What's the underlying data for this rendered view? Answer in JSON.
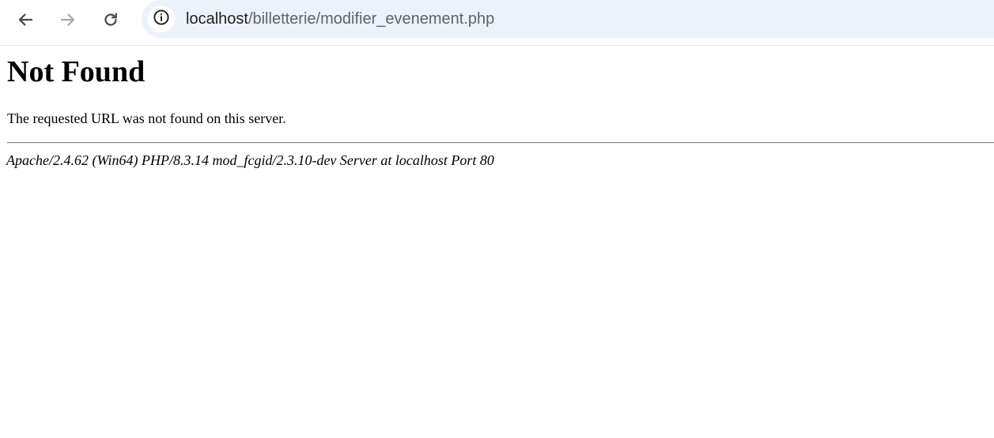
{
  "browser": {
    "address_bar": {
      "host": "localhost",
      "path": "/billetterie/modifier_evenement.php"
    },
    "icons": {
      "back": "arrow-left-icon",
      "forward": "arrow-right-icon",
      "reload": "reload-icon",
      "site_info": "info-icon"
    },
    "colors": {
      "omnibox_bg": "#edf2fa",
      "path_text": "#5f6368"
    }
  },
  "page": {
    "heading": "Not Found",
    "message": "The requested URL was not found on this server.",
    "server_signature": "Apache/2.4.62 (Win64) PHP/8.3.14 mod_fcgid/2.3.10-dev Server at localhost Port 80"
  }
}
